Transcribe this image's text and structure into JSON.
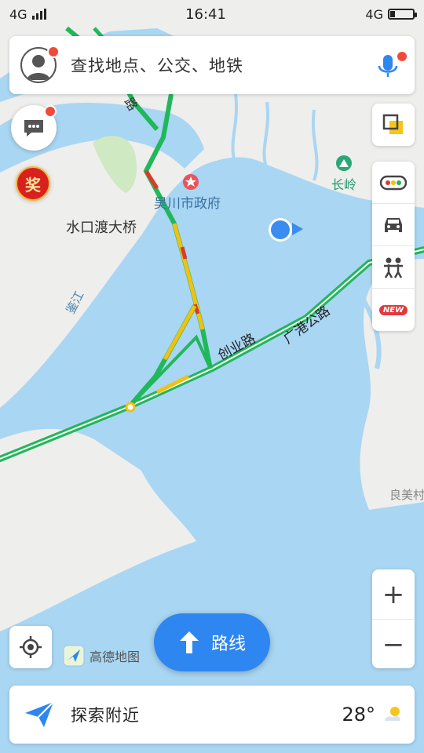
{
  "status_bar": {
    "time": "16:41",
    "left_network": "4G",
    "right_network": "4G"
  },
  "search": {
    "placeholder": "查找地点、公交、地铁"
  },
  "map": {
    "labels": {
      "bridge": "水口渡大桥",
      "government": "吴川市政府",
      "changling": "长岭",
      "road_chuangye": "创业路",
      "road_guanggang": "广港公路",
      "river": "鉴江",
      "liangmei": "良美村",
      "road_fragment": "路"
    }
  },
  "toolbar": {
    "new_badge": "NEW",
    "reward_label": "奖"
  },
  "zoom": {
    "in_label": "+",
    "out_label": "−"
  },
  "route_button": {
    "label": "路线"
  },
  "brand": {
    "logo_text": "高德地图"
  },
  "bottom_bar": {
    "label": "探索附近",
    "temperature": "28°"
  },
  "colors": {
    "water": "#a9d6f2",
    "land": "#eeeeec",
    "road_green": "#21b75b",
    "road_yellow": "#f2c110",
    "road_red": "#d93a2b",
    "accent_blue": "#2e86f0"
  }
}
